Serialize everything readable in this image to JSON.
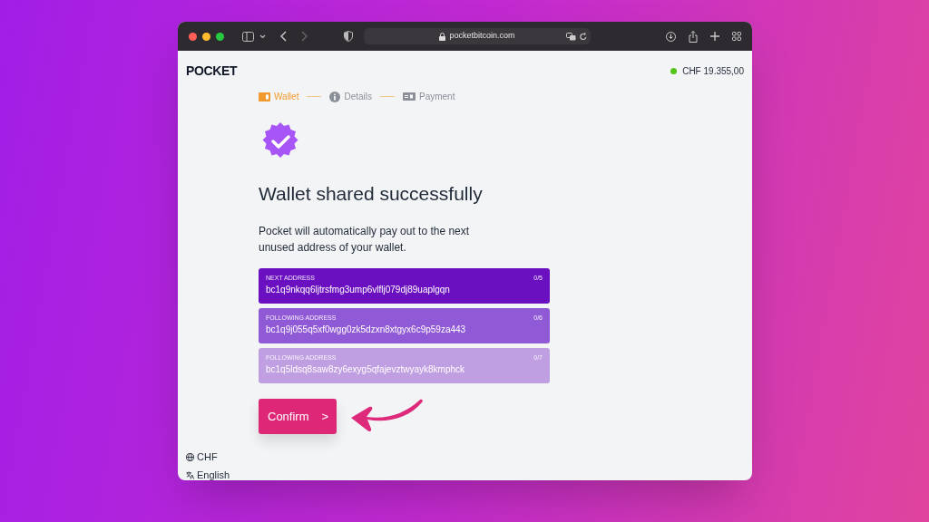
{
  "browser": {
    "address": "pocketbitcoin.com"
  },
  "header": {
    "logo": "POCKET",
    "balance": "CHF 19.355,00",
    "online": true
  },
  "steps": [
    {
      "kind": "wallet",
      "label": "Wallet",
      "selected": true
    },
    {
      "kind": "details",
      "label": "Details",
      "selected": false
    },
    {
      "kind": "payment",
      "label": "Payment",
      "selected": false
    }
  ],
  "title": "Wallet shared successfully",
  "description": "Pocket will automatically pay out to the next unused address of your wallet.",
  "addresses": [
    {
      "label": "NEXT ADDRESS",
      "index": "0/5",
      "address": "bc1q9nkqq6ljtrsfmg3ump6vlflj079dj89uaplgqn",
      "color": "#6b10c0"
    },
    {
      "label": "FOLLOWING ADDRESS",
      "index": "0/6",
      "address": "bc1q9j055q5xf0wgg0zk5dzxn8xtgyx6c9p59za443",
      "color": "#9059d6"
    },
    {
      "label": "FOLLOWING ADDRESS",
      "index": "0/7",
      "address": "bc1q5ldsq8saw8zy6exyg5qfajevztwyayk8kmphck",
      "color": "#c09ee2"
    }
  ],
  "confirm_button": {
    "label": "Confirm",
    "icon": ">"
  },
  "footer": [
    {
      "kind": "currency",
      "label": "CHF"
    },
    {
      "kind": "language",
      "label": "English"
    }
  ]
}
